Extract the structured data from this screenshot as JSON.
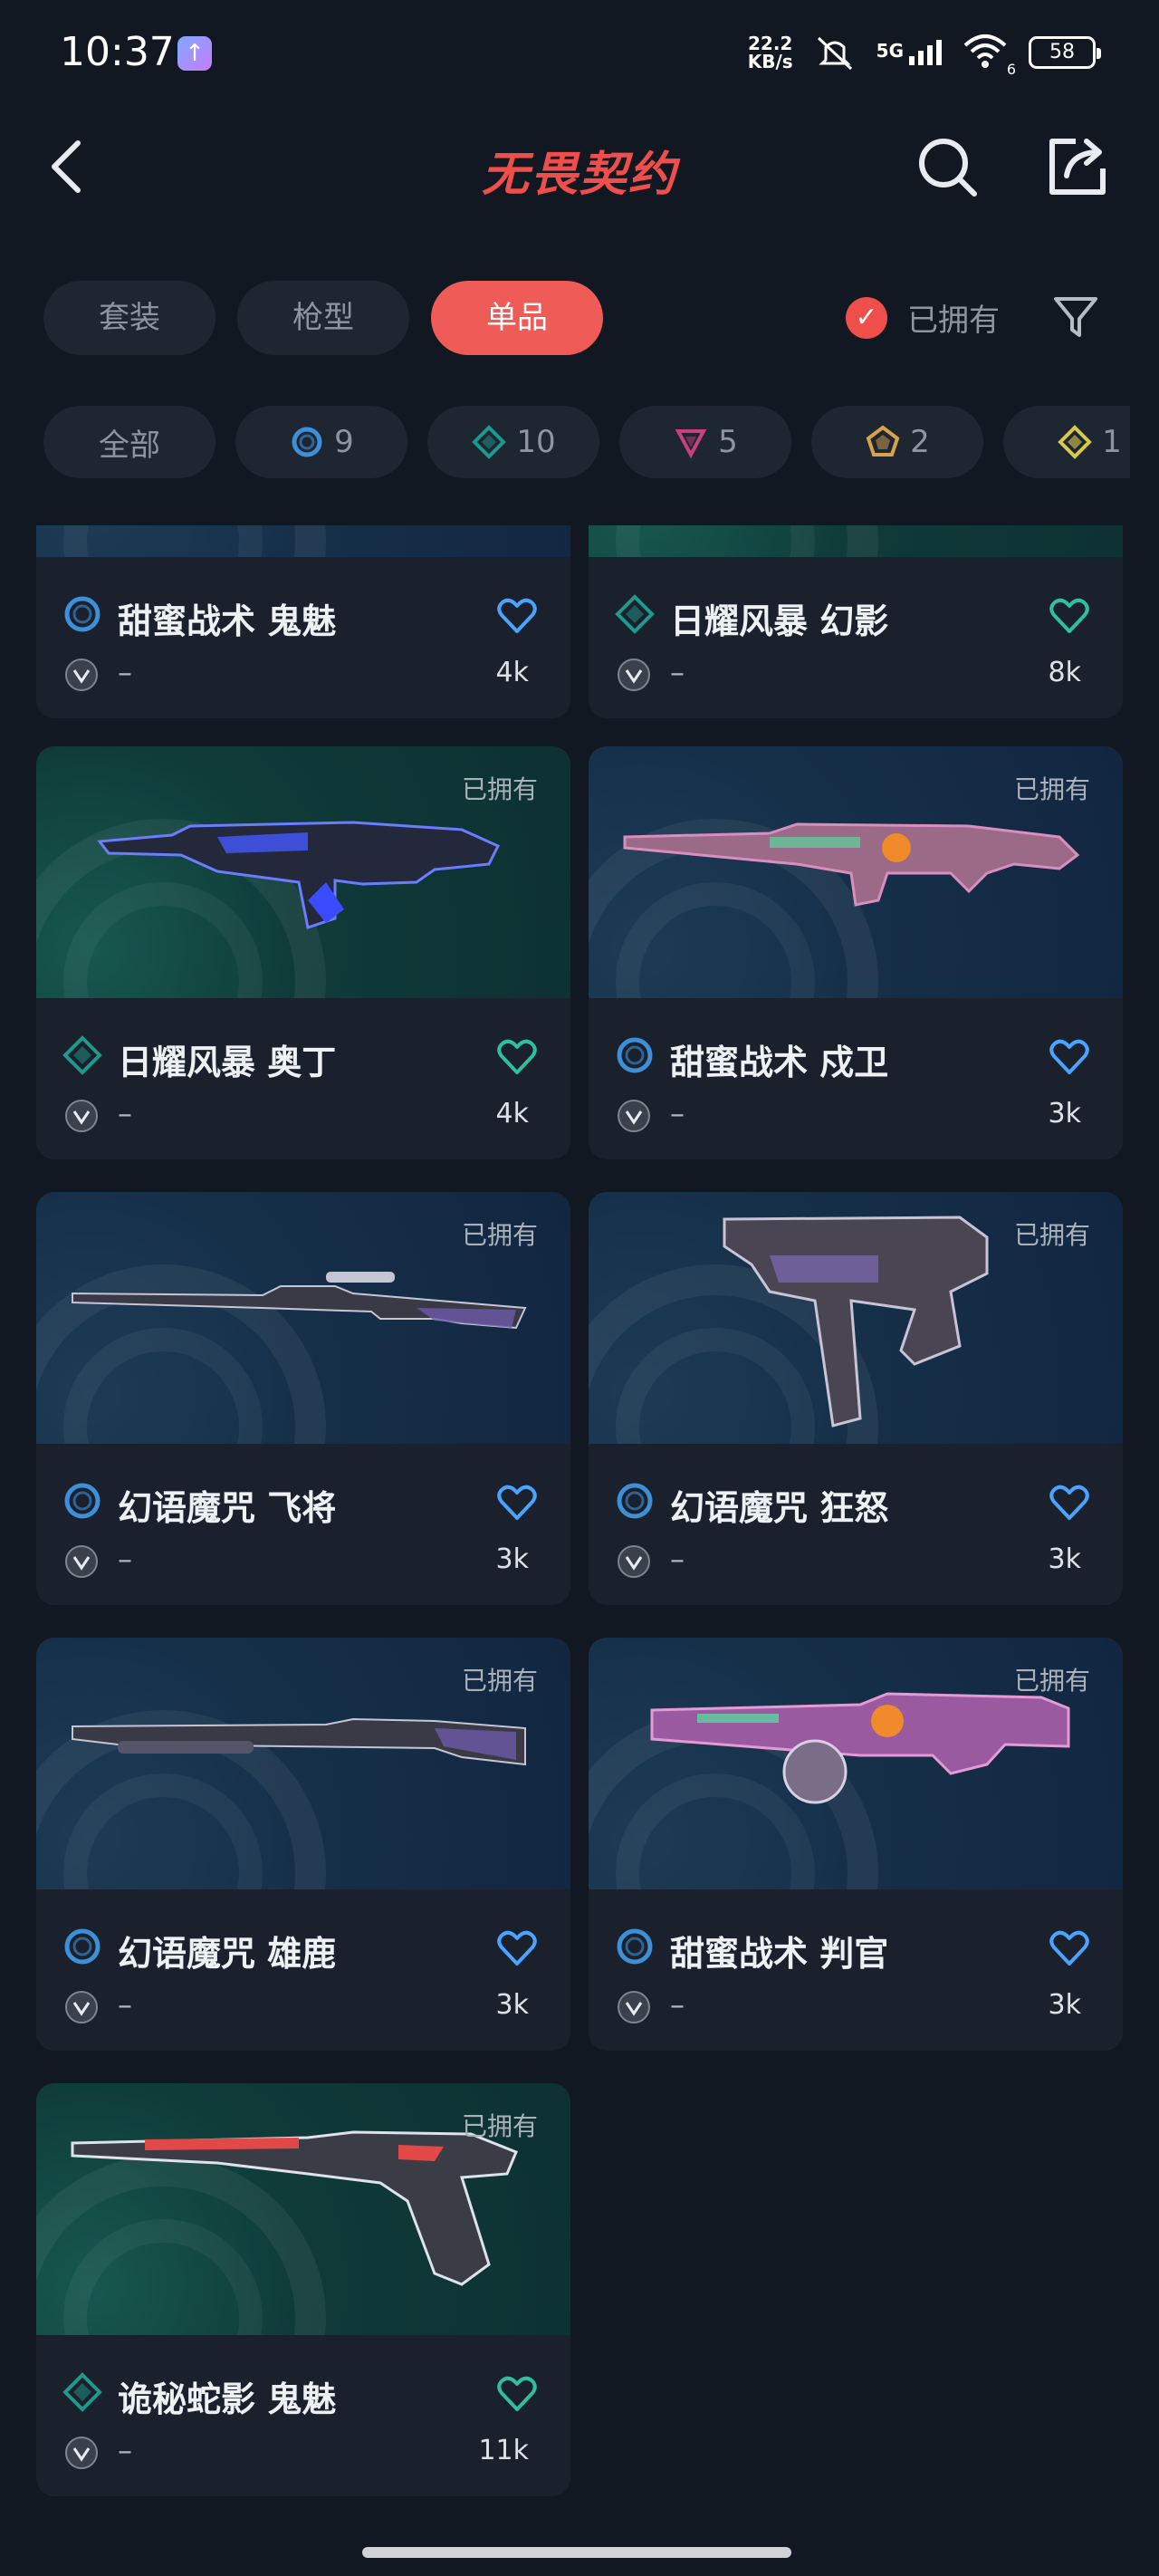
{
  "status_bar": {
    "time": "10:37",
    "net_speed_value": "22.2",
    "net_speed_unit": "KB/s",
    "network_type": "5G",
    "wifi_level": "6",
    "battery": "58"
  },
  "header": {
    "title": "无畏契约"
  },
  "tabs": [
    {
      "label": "套装",
      "active": false
    },
    {
      "label": "枪型",
      "active": false
    },
    {
      "label": "单品",
      "active": true
    }
  ],
  "owned_filter": {
    "label": "已拥有",
    "checked": true
  },
  "rarity_filters": [
    {
      "label": "全部",
      "count": ""
    },
    {
      "label": "",
      "count": "9",
      "tier": "select",
      "color": "#3d8fd8"
    },
    {
      "label": "",
      "count": "10",
      "tier": "deluxe",
      "color": "#1d9a8a"
    },
    {
      "label": "",
      "count": "5",
      "tier": "premium",
      "color": "#c8407c"
    },
    {
      "label": "",
      "count": "2",
      "tier": "exclusive",
      "color": "#d7a24a"
    },
    {
      "label": "",
      "count": "1",
      "tier": "ultra",
      "color": "#d8c94a"
    }
  ],
  "cards": [
    {
      "name": "甜蜜战术 鬼魅",
      "tier": "select",
      "price": "–",
      "likes": "4k",
      "owned_label": "",
      "bg": "blue",
      "fav_color": "#4aa3ff"
    },
    {
      "name": "日耀风暴 幻影",
      "tier": "deluxe",
      "price": "–",
      "likes": "8k",
      "owned_label": "",
      "bg": "teal",
      "fav_color": "#2fbf9a"
    },
    {
      "name": "日耀风暴 奥丁",
      "tier": "deluxe",
      "price": "–",
      "likes": "4k",
      "owned_label": "已拥有",
      "bg": "teal",
      "fav_color": "#2fbf9a"
    },
    {
      "name": "甜蜜战术 戍卫",
      "tier": "select",
      "price": "–",
      "likes": "3k",
      "owned_label": "已拥有",
      "bg": "blue",
      "fav_color": "#4aa3ff"
    },
    {
      "name": "幻语魔咒 飞将",
      "tier": "select",
      "price": "–",
      "likes": "3k",
      "owned_label": "已拥有",
      "bg": "blue",
      "fav_color": "#4aa3ff"
    },
    {
      "name": "幻语魔咒 狂怒",
      "tier": "select",
      "price": "–",
      "likes": "3k",
      "owned_label": "已拥有",
      "bg": "blue",
      "fav_color": "#4aa3ff"
    },
    {
      "name": "幻语魔咒 雄鹿",
      "tier": "select",
      "price": "–",
      "likes": "3k",
      "owned_label": "已拥有",
      "bg": "blue",
      "fav_color": "#4aa3ff"
    },
    {
      "name": "甜蜜战术 判官",
      "tier": "select",
      "price": "–",
      "likes": "3k",
      "owned_label": "已拥有",
      "bg": "blue",
      "fav_color": "#4aa3ff"
    },
    {
      "name": "诡秘蛇影 鬼魅",
      "tier": "deluxe",
      "price": "–",
      "likes": "11k",
      "owned_label": "已拥有",
      "bg": "teal",
      "fav_color": "#2fbf9a"
    }
  ]
}
